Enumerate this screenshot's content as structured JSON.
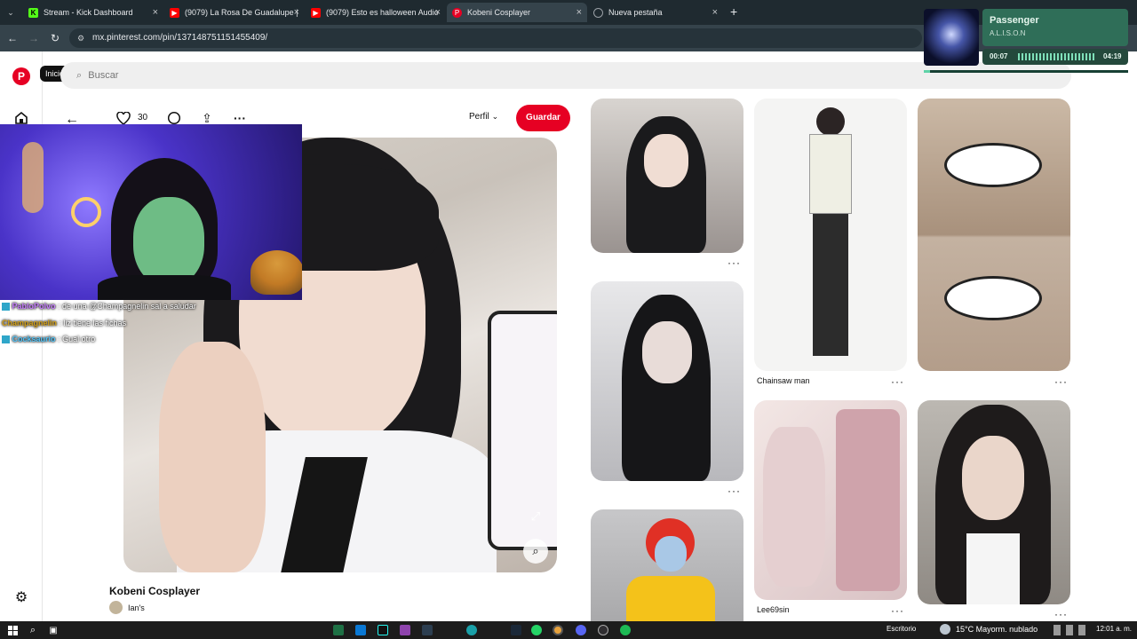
{
  "browser": {
    "tabs": [
      {
        "title": "Stream - Kick Dashboard",
        "favicon": "kick-icon",
        "color": "#53fc18"
      },
      {
        "title": "(9079) La Rosa De Guadalupe |",
        "favicon": "youtube-icon",
        "color": "#ff0000"
      },
      {
        "title": "(9079) Esto es halloween Audio",
        "favicon": "youtube-icon",
        "color": "#ff0000"
      },
      {
        "title": "Kobeni Cosplayer",
        "favicon": "pinterest-icon",
        "color": "#e60023"
      },
      {
        "title": "Nueva pestaña",
        "favicon": "globe-icon",
        "color": "#9aa0a6"
      }
    ],
    "new_tab": "+",
    "url": "mx.pinterest.com/pin/137148751151455409/"
  },
  "pinterest": {
    "tooltip_home": "Inicio",
    "search_placeholder": "Buscar",
    "like_count": "30",
    "profile_label": "Perfil",
    "save_label": "Guardar",
    "pin_title": "Kobeni Cosplayer",
    "author": "Ian's",
    "brand_color": "#e60023",
    "feed": [
      {
        "caption": "",
        "more": "···"
      },
      {
        "caption": "Chainsaw man",
        "more": "···"
      },
      {
        "caption": "",
        "more": "···"
      },
      {
        "caption": "",
        "more": "···"
      },
      {
        "caption": "Lee69sin",
        "more": "···"
      },
      {
        "caption": "",
        "more": "···"
      }
    ]
  },
  "stream_overlay": {
    "chat": [
      {
        "user": "PabloPolvo",
        "msg": ": de una @Champagnelin sal a saludar",
        "color": "#c77dff"
      },
      {
        "user": "Champagnelin",
        "msg": ": liz tiene las fichas",
        "color": "#d4a017"
      },
      {
        "user": "Cocksaurio",
        "msg": ": Gual otro",
        "color": "#4fc3f7"
      }
    ],
    "music": {
      "song": "Passenger",
      "artist": "A.L.I.S.O.N",
      "elapsed": "00:07",
      "duration": "04:19",
      "progress": 0.03,
      "accent": "#5fd3a8"
    }
  },
  "taskbar": {
    "weather": "15°C  Mayorm. nublado",
    "desktop": "Escritorio",
    "time": "12:01 a. m."
  }
}
